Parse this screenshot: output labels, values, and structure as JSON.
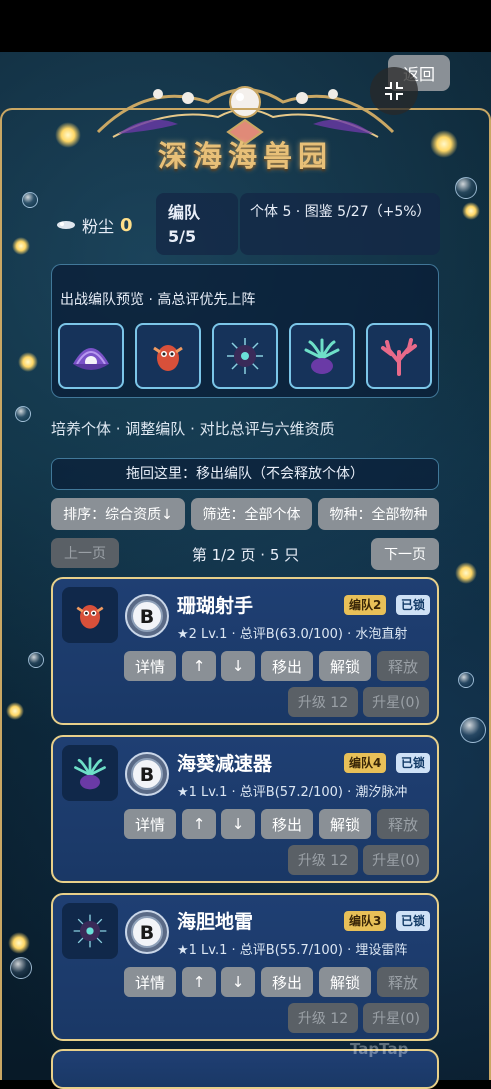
{
  "header": {
    "title": "深海海兽园",
    "back_label": "返回"
  },
  "stats": {
    "dust_label": "粉尘",
    "dust_value": "0",
    "team_label": "编队",
    "team_value": "5/5",
    "info_text": "个体 5 · 图鉴 5/27（+5%）"
  },
  "preview": {
    "label": "出战编队预览 · 高总评优先上阵",
    "slots": [
      "clam-icon",
      "red-sea-creature-icon",
      "sea-urchin-icon",
      "anemone-icon",
      "coral-icon"
    ]
  },
  "hint_text": "培养个体 · 调整编队 · 对比总评与六维资质",
  "drop_zone": "拖回这里：移出编队（不会释放个体）",
  "filters": {
    "sort": "排序：综合资质↓",
    "filter": "筛选：全部个体",
    "species": "物种：全部物种"
  },
  "pagination": {
    "prev": "上一页",
    "info": "第 1/2 页 · 5 只",
    "next": "下一页"
  },
  "cards": [
    {
      "name": "珊瑚射手",
      "grade": "B",
      "team_tag": "编队2",
      "lock_tag": "已锁",
      "meta": "★2 Lv.1 · 总评B(63.0/100) · 水泡直射",
      "actions": [
        "详情",
        "↑",
        "↓",
        "移出",
        "解锁",
        "释放"
      ],
      "upgrade": "升级 12",
      "star": "升星(0)"
    },
    {
      "name": "海葵减速器",
      "grade": "B",
      "team_tag": "编队4",
      "lock_tag": "已锁",
      "meta": "★1 Lv.1 · 总评B(57.2/100) · 潮汐脉冲",
      "actions": [
        "详情",
        "↑",
        "↓",
        "移出",
        "解锁",
        "释放"
      ],
      "upgrade": "升级 12",
      "star": "升星(0)"
    },
    {
      "name": "海胆地雷",
      "grade": "B",
      "team_tag": "编队3",
      "lock_tag": "已锁",
      "meta": "★1 Lv.1 · 总评B(55.7/100) · 埋设雷阵",
      "actions": [
        "详情",
        "↑",
        "↓",
        "移出",
        "解锁",
        "释放"
      ],
      "upgrade": "升级 12",
      "star": "升星(0)"
    }
  ],
  "watermark": "TapTap"
}
